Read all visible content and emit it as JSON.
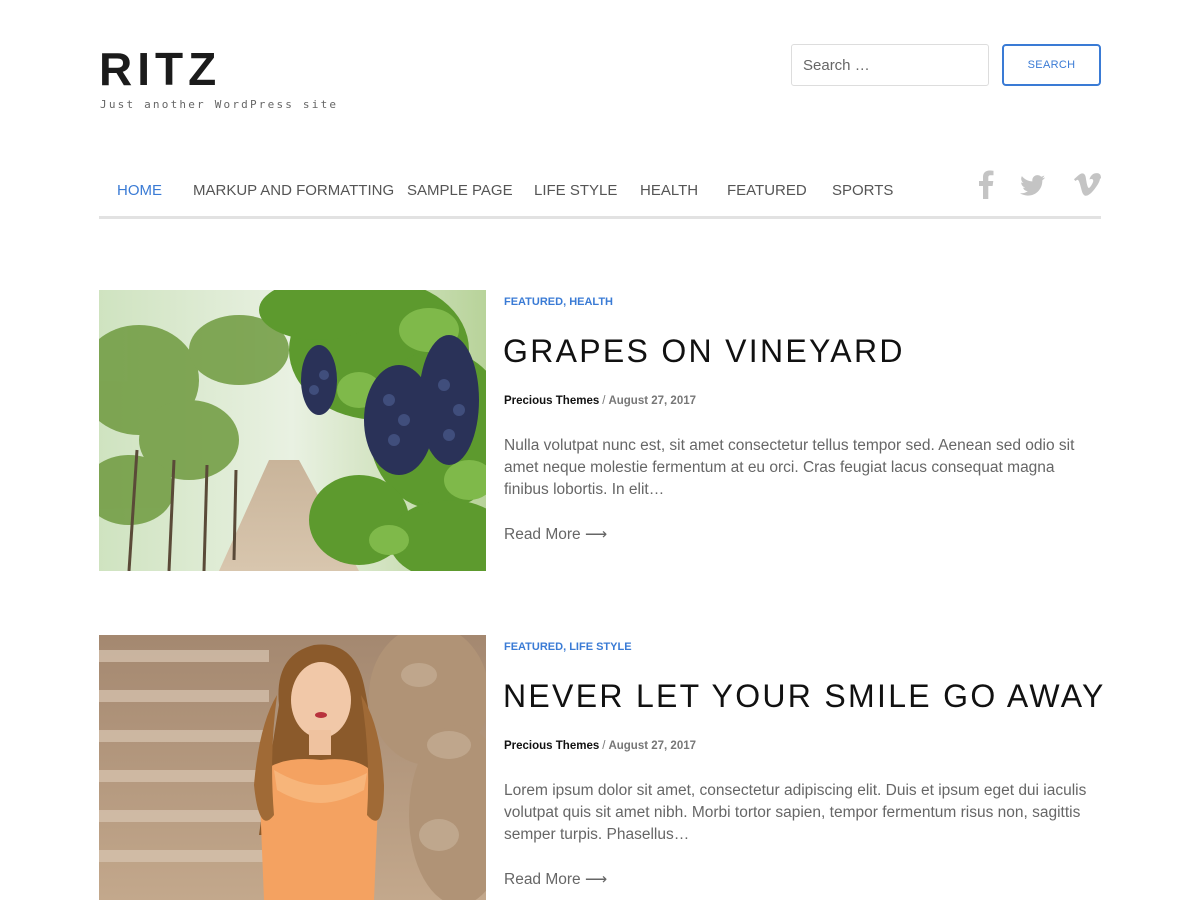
{
  "site": {
    "title": "RITZ",
    "tagline": "Just another WordPress site"
  },
  "search": {
    "placeholder": "Search …",
    "button_label": "Search"
  },
  "nav": {
    "items": [
      {
        "label": "HOME",
        "active": true
      },
      {
        "label": "MARKUP AND FORMATTING"
      },
      {
        "label": "SAMPLE PAGE"
      },
      {
        "label": "LIFE STYLE"
      },
      {
        "label": "HEALTH"
      },
      {
        "label": "FEATURED"
      },
      {
        "label": "SPORTS"
      }
    ],
    "social": [
      "facebook-icon",
      "twitter-icon",
      "vimeo-icon"
    ]
  },
  "posts": [
    {
      "categories": [
        "FEATURED",
        "HEALTH"
      ],
      "title": "GRAPES ON VINEYARD",
      "author": "Precious Themes",
      "date": "August 27, 2017",
      "excerpt": "Nulla volutpat nunc est, sit amet consectetur tellus tempor sed. Aenean sed odio sit amet neque molestie fermentum at eu orci. Cras feugiat lacus consequat magna finibus lobortis. In elit…",
      "read_more": "Read More ⟶"
    },
    {
      "categories": [
        "FEATURED",
        "LIFE STYLE"
      ],
      "title": "NEVER LET YOUR SMILE GO AWAY",
      "author": "Precious Themes",
      "date": "August 27, 2017",
      "excerpt": "Lorem ipsum dolor sit amet, consectetur adipiscing elit. Duis et ipsum eget dui iaculis volutpat quis sit amet nibh. Morbi tortor sapien, tempor fermentum risus non, sagittis semper turpis. Phasellus…",
      "read_more": "Read More ⟶"
    }
  ],
  "colors": {
    "accent": "#3a7bd5",
    "text": "#666666",
    "heading": "#111111"
  }
}
